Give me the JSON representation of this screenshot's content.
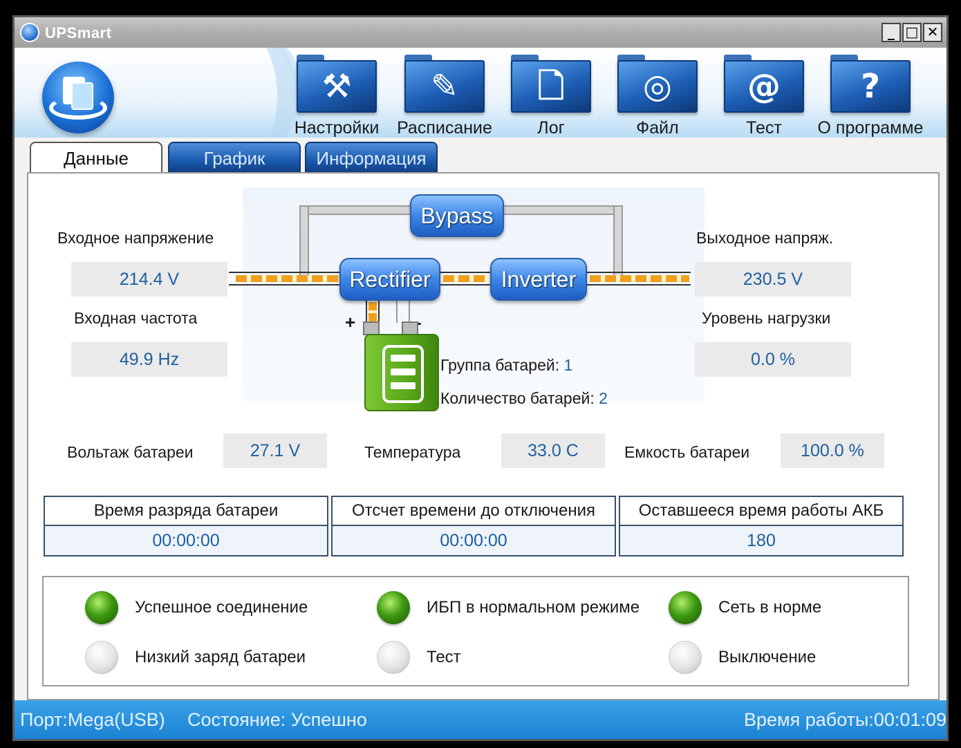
{
  "window": {
    "title": "UPSmart",
    "min": "_",
    "max": "□",
    "close": "✕"
  },
  "toolbar": [
    {
      "label": "Настройки",
      "icon": "hammer-icon",
      "glyph": "⚒"
    },
    {
      "label": "Расписание",
      "icon": "pencil-icon",
      "glyph": "✎"
    },
    {
      "label": "Лог",
      "icon": "document-icon",
      "glyph": "🗋"
    },
    {
      "label": "Файл",
      "icon": "disc-icon",
      "glyph": "◎"
    },
    {
      "label": "Тест",
      "icon": "at-icon",
      "glyph": "@"
    },
    {
      "label": "О программе",
      "icon": "question-icon",
      "glyph": "?"
    }
  ],
  "tabs": [
    "Данные",
    "График",
    "Информация"
  ],
  "input": {
    "voltage_label": "Входное напряжение",
    "voltage": "214.4 V",
    "freq_label": "Входная частота",
    "freq": "49.9 Hz"
  },
  "output": {
    "voltage_label": "Выходное напряж.",
    "voltage": "230.5 V",
    "load_label": "Уровень нагрузки",
    "load": "0.0 %"
  },
  "diagram": {
    "bypass": "Bypass",
    "rectifier": "Rectifier",
    "inverter": "Inverter",
    "plus": "+",
    "minus": "-",
    "group_label": "Группа батарей:",
    "group_value": "1",
    "count_label": "Количество батарей:",
    "count_value": "2"
  },
  "battery": {
    "voltage_label": "Вольтаж батареи",
    "voltage": "27.1 V",
    "temp_label": "Температура",
    "temp": "33.0 C",
    "capacity_label": "Емкость батареи",
    "capacity": "100.0 %"
  },
  "timers": [
    {
      "header": "Время разряда батареи",
      "value": "00:00:00"
    },
    {
      "header": "Отсчет времени до отключения",
      "value": "00:00:00"
    },
    {
      "header": "Оставшееся время работы АКБ",
      "value": "180"
    }
  ],
  "indicators": [
    {
      "label": "Успешное соединение",
      "state": "on"
    },
    {
      "label": "ИБП в нормальном режиме",
      "state": "on"
    },
    {
      "label": "Сеть в норме",
      "state": "on"
    },
    {
      "label": "Низкий заряд батареи",
      "state": "off"
    },
    {
      "label": "Тест",
      "state": "off"
    },
    {
      "label": "Выключение",
      "state": "off"
    }
  ],
  "statusbar": {
    "port": "Порт:Mega(USB)",
    "state": "Состояние: Успешно",
    "uptime": "Время работы:00:01:09"
  },
  "colors": {
    "accent": "#1b82d2",
    "value_text": "#1f5f9e",
    "led_on": "#3e9a12"
  }
}
